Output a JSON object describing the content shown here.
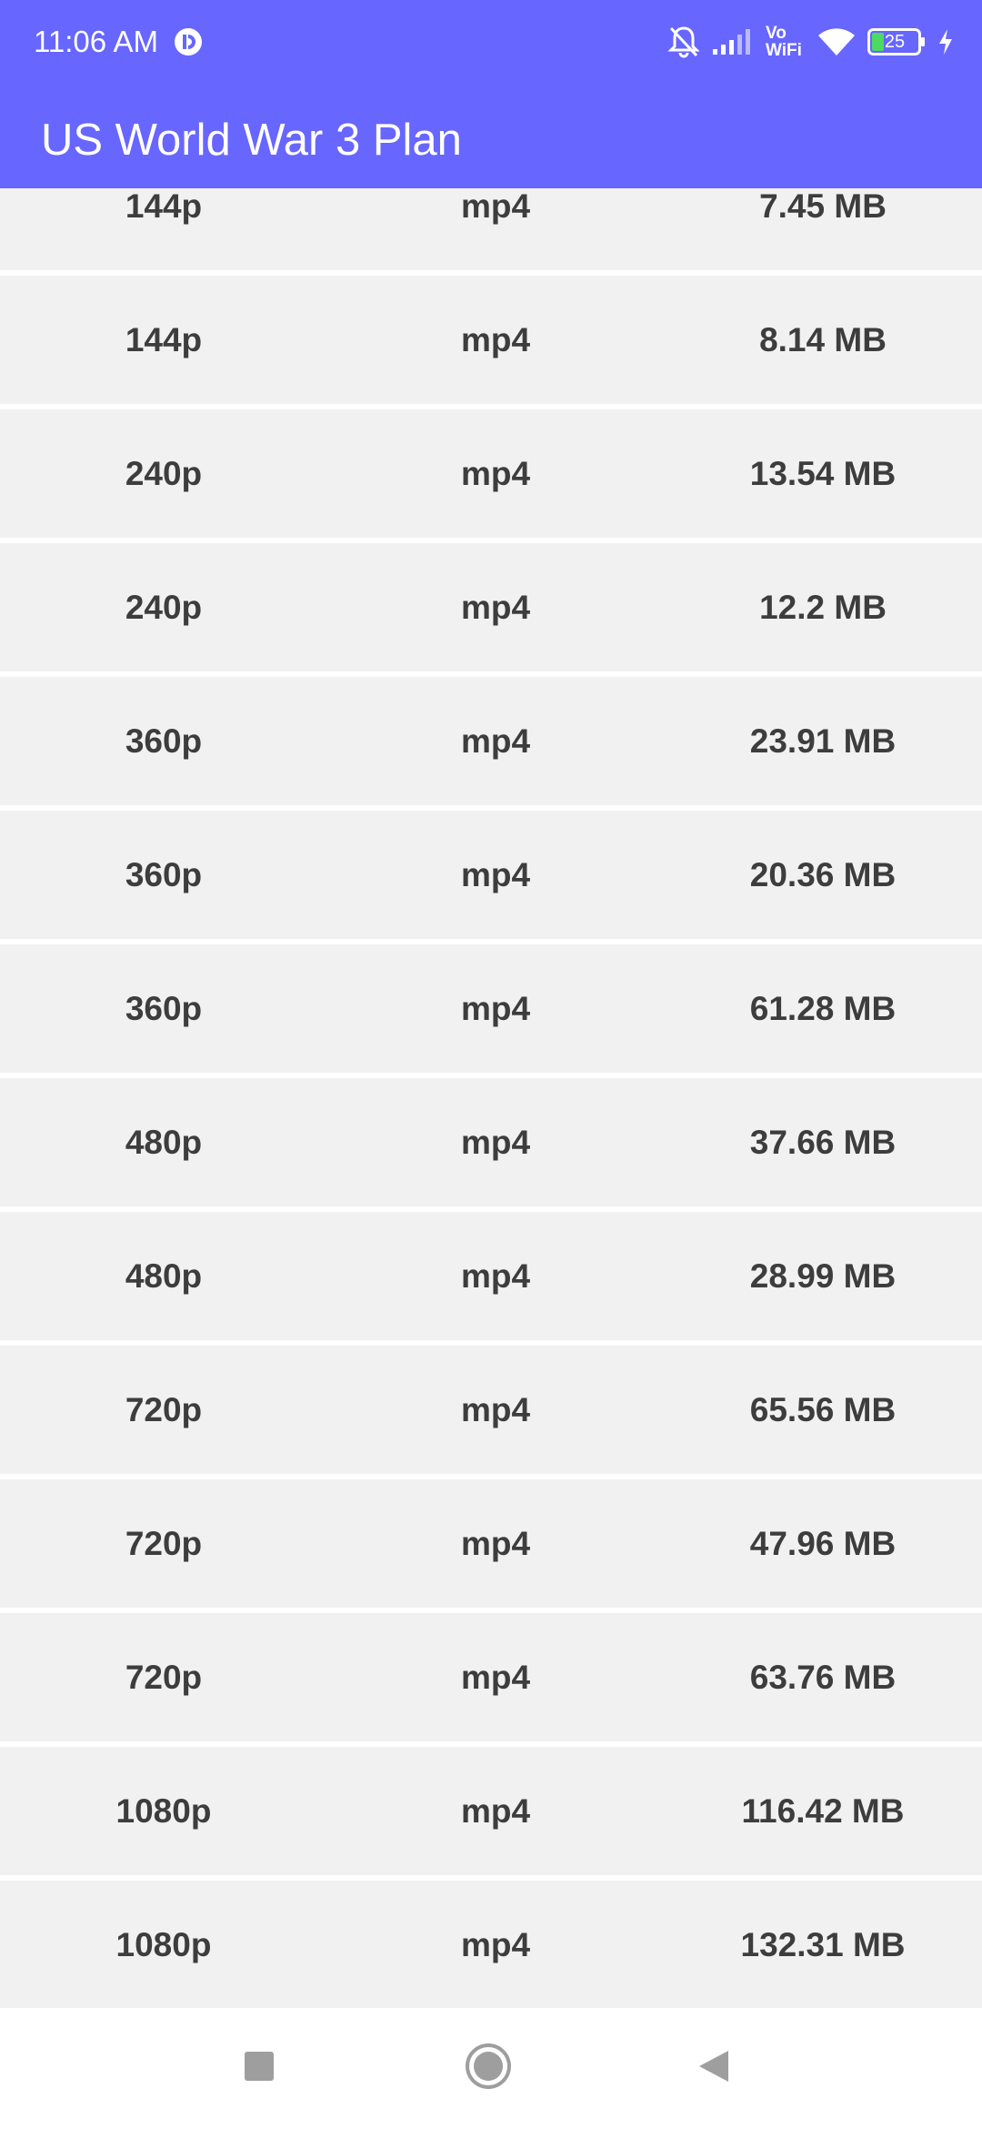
{
  "status_bar": {
    "time": "11:06 AM",
    "vowifi_line1": "Vo",
    "vowifi_line2": "WiFi",
    "battery_level": "25"
  },
  "app_bar": {
    "title": "US World War 3 Plan"
  },
  "rows": [
    {
      "resolution": "144p",
      "format": "mp4",
      "size": "7.45 MB"
    },
    {
      "resolution": "144p",
      "format": "mp4",
      "size": "8.14 MB"
    },
    {
      "resolution": "240p",
      "format": "mp4",
      "size": "13.54 MB"
    },
    {
      "resolution": "240p",
      "format": "mp4",
      "size": "12.2 MB"
    },
    {
      "resolution": "360p",
      "format": "mp4",
      "size": "23.91 MB"
    },
    {
      "resolution": "360p",
      "format": "mp4",
      "size": "20.36 MB"
    },
    {
      "resolution": "360p",
      "format": "mp4",
      "size": "61.28 MB"
    },
    {
      "resolution": "480p",
      "format": "mp4",
      "size": "37.66 MB"
    },
    {
      "resolution": "480p",
      "format": "mp4",
      "size": "28.99 MB"
    },
    {
      "resolution": "720p",
      "format": "mp4",
      "size": "65.56 MB"
    },
    {
      "resolution": "720p",
      "format": "mp4",
      "size": "47.96 MB"
    },
    {
      "resolution": "720p",
      "format": "mp4",
      "size": "63.76 MB"
    },
    {
      "resolution": "1080p",
      "format": "mp4",
      "size": "116.42 MB"
    },
    {
      "resolution": "1080p",
      "format": "mp4",
      "size": "132.31 MB"
    }
  ],
  "colors": {
    "app_bar": "#6766ff",
    "row_background": "#f1f1f1",
    "row_text": "#3d3d3d",
    "battery_fill": "#4cd964"
  },
  "icons": {
    "status_app": "notification-app-icon",
    "mute": "bell-off-icon",
    "signal": "cell-signal-icon",
    "wifi": "wifi-icon",
    "battery": "battery-icon",
    "charging": "charging-bolt-icon",
    "nav_recents": "square-icon",
    "nav_home": "circle-icon",
    "nav_back": "triangle-back-icon"
  }
}
